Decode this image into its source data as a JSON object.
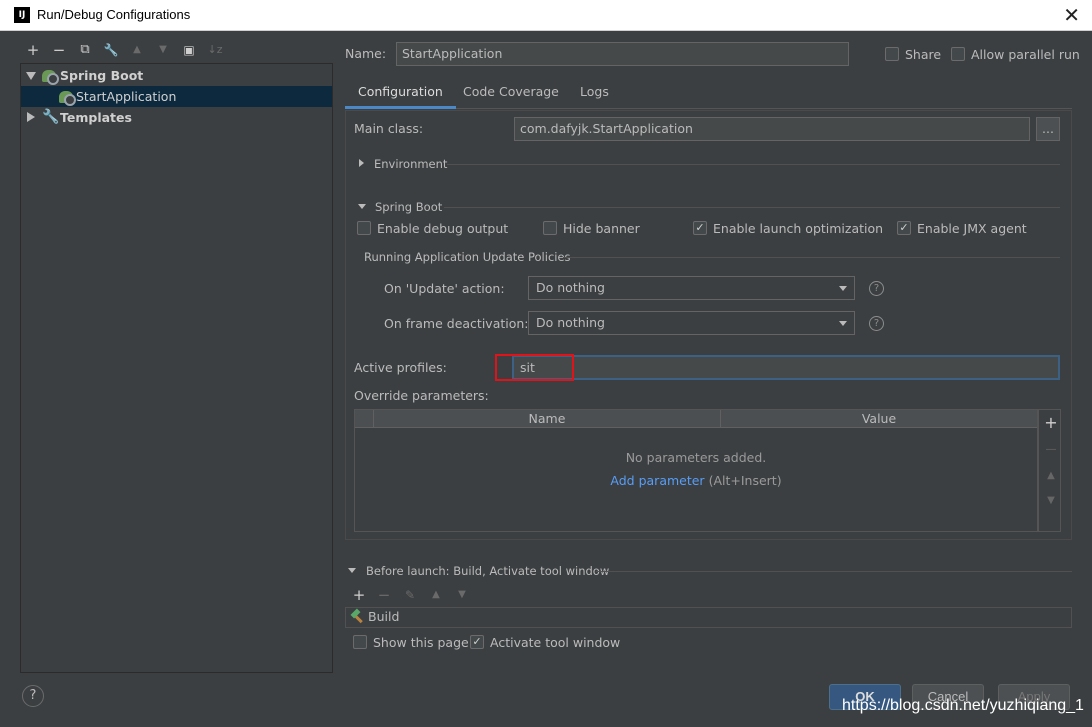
{
  "window": {
    "title": "Run/Debug Configurations",
    "app_icon": "IJ",
    "close_glyph": "✕"
  },
  "toolbar": {
    "add": "+",
    "remove": "−",
    "copy": "⧉",
    "edit": "🔧",
    "up": "▲",
    "down": "▼",
    "folder": "▣",
    "sort": "↓z"
  },
  "tree": {
    "groups": [
      {
        "label": "Spring Boot",
        "expanded": true,
        "icon": "spring-boot-icon"
      },
      {
        "label": "Templates",
        "expanded": false,
        "icon": "wrench-icon"
      }
    ],
    "selected_item": "StartApplication"
  },
  "header": {
    "name_label": "Name:",
    "name_value": "StartApplication",
    "share_label": "Share",
    "share_checked": false,
    "parallel_label": "Allow parallel run",
    "parallel_checked": false
  },
  "tabs": [
    {
      "label": "Configuration",
      "active": true
    },
    {
      "label": "Code Coverage",
      "active": false
    },
    {
      "label": "Logs",
      "active": false
    }
  ],
  "config": {
    "main_class_label": "Main class:",
    "main_class_value": "com.dafyjk.StartApplication",
    "browse_label": "...",
    "environment_label": "Environment",
    "spring_boot_label": "Spring Boot",
    "options": [
      {
        "label": "Enable debug output",
        "checked": false
      },
      {
        "label": "Hide banner",
        "checked": false
      },
      {
        "label": "Enable launch optimization",
        "checked": true
      },
      {
        "label": "Enable JMX agent",
        "checked": true
      }
    ],
    "policies_label": "Running Application Update Policies",
    "update_action_label": "On 'Update' action:",
    "update_action_value": "Do nothing",
    "frame_deactivation_label": "On frame deactivation:",
    "frame_deactivation_value": "Do nothing",
    "help_glyph": "?",
    "active_profiles_label": "Active profiles:",
    "active_profiles_value": "sit",
    "override_label": "Override parameters:",
    "table_headers": [
      "Name",
      "Value"
    ],
    "empty_text": "No parameters added.",
    "add_param_link": "Add parameter",
    "add_param_shortcut": "(Alt+Insert)"
  },
  "before_launch": {
    "label": "Before launch: Build, Activate tool window",
    "tasks": [
      "Build"
    ],
    "show_page_label": "Show this page",
    "show_page_checked": false,
    "activate_label": "Activate tool window",
    "activate_checked": true
  },
  "footer": {
    "help": "?",
    "ok": "OK",
    "cancel": "Cancel",
    "apply": "Apply"
  },
  "watermark": "https://blog.csdn.net/yuzhiqiang_1",
  "colors": {
    "background": "#3c3f41",
    "selection": "#0d293e",
    "accent": "#4a88c7",
    "highlight_box": "#e0131b",
    "link": "#589df6"
  }
}
